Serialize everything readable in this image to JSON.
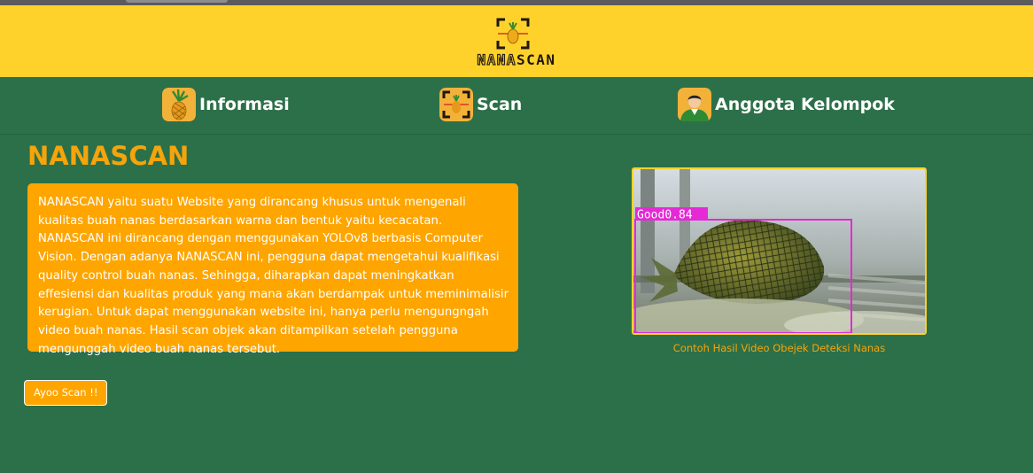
{
  "brand": {
    "name_part1": "NANA",
    "name_part2": "SCAN",
    "logo_icon": "pineapple-scan-frame-icon"
  },
  "nav": {
    "items": [
      {
        "label": "Informasi",
        "icon": "pineapple-icon"
      },
      {
        "label": "Scan",
        "icon": "scan-frame-icon"
      },
      {
        "label": "Anggota Kelompok",
        "icon": "person-avatar-icon"
      }
    ]
  },
  "main": {
    "title": "NANASCAN",
    "description": "NANASCAN yaitu suatu Website yang dirancang khusus untuk mengenali kualitas buah nanas berdasarkan warna dan bentuk yaitu kecacatan. NANASCAN ini dirancang dengan menggunakan YOLOv8 berbasis Computer Vision. Dengan adanya NANASCAN ini, pengguna dapat mengetahui kualifikasi quality control buah nanas. Sehingga, diharapkan dapat meningkatkan effesiensi dan kualitas produk yang mana akan berdampak untuk meminimalisir kerugian. Untuk dapat menggunakan website ini, hanya perlu mengungngah video buah nanas. Hasil scan objek akan ditampilkan setelah pengguna mengunggah video buah nanas tersebut.",
    "cta_label": "Ayoo Scan !!"
  },
  "demo": {
    "detection_label": "Good",
    "detection_score": "0.84",
    "caption": "Contoh Hasil Video Obejek Deteksi Nanas"
  },
  "colors": {
    "brand_yellow": "#fed22b",
    "green": "#2c7049",
    "orange": "#fea500",
    "title_orange": "#f5a40b",
    "detection_box": "#e529d6"
  }
}
